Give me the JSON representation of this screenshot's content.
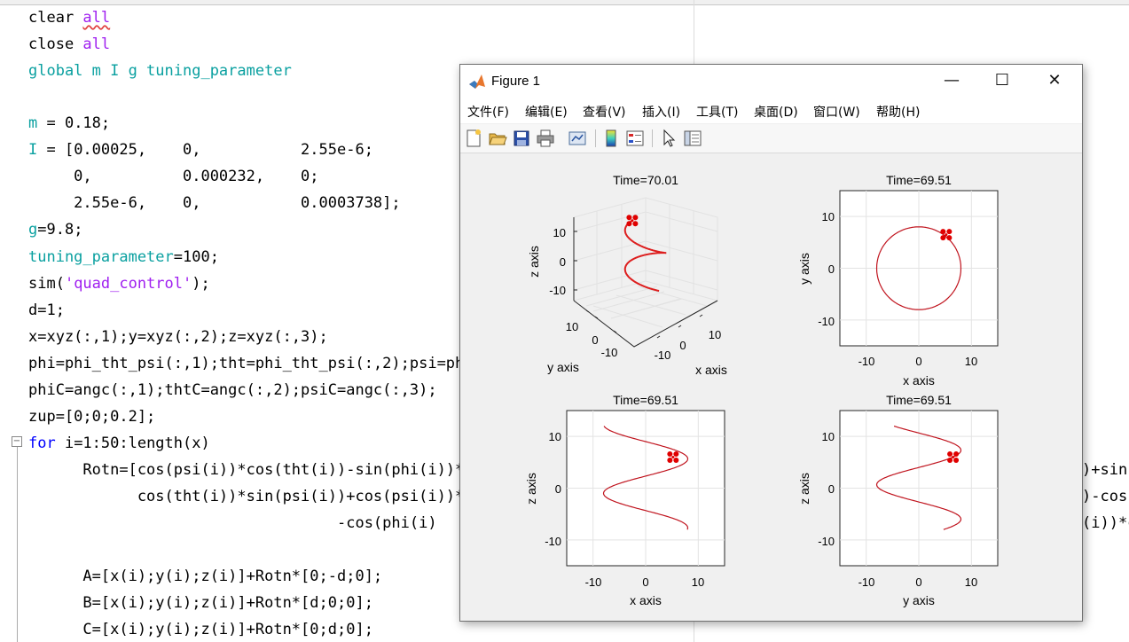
{
  "editor": {
    "l1": {
      "a": "clear ",
      "b": "all"
    },
    "l2": {
      "a": "close ",
      "b": "all"
    },
    "l3": "global m I g tuning_parameter",
    "l5": {
      "a": "m",
      "b": " = 0.18;"
    },
    "l6": {
      "a": "I",
      "b": " = [0.00025,    0,           2.55e-6;"
    },
    "l7": "     0,          0.000232,    0;",
    "l8": "     2.55e-6,    0,           0.0003738];",
    "l9": {
      "a": "g",
      "b": "=9.8;"
    },
    "l10": {
      "a": "tuning_parameter",
      "b": "=100;"
    },
    "l11": {
      "a": "sim(",
      "b": "'quad_control'",
      "c": ");"
    },
    "l12": "d=1;",
    "l13": "x=xyz(:,1);y=xyz(:,2);z=xyz(:,3);",
    "l14": "phi=phi_tht_psi(:,1);tht=phi_tht_psi(:,2);psi=phi",
    "l15": "phiC=angc(:,1);thtC=angc(:,2);psiC=angc(:,3);",
    "l16": "zup=[0;0;0.2];",
    "l17": {
      "a": "for",
      "b": " i=1:50:length(x)"
    },
    "l18": "      Rotn=[cos(psi(i))*cos(tht(i))-sin(phi(i))*s",
    "l18r": ")+sin",
    "l19": "            cos(tht(i))*sin(psi(i))+cos(psi(i))*s",
    "l19r": ")-cos",
    "l20": "                                  -cos(phi(i)",
    "l20r": "(i))*c",
    "l22": "      A=[x(i);y(i);z(i)]+Rotn*[0;-d;0];",
    "l23": "      B=[x(i);y(i);z(i)]+Rotn*[d;0;0];",
    "l24": "      C=[x(i);y(i);z(i)]+Rotn*[0;d;0];",
    "fold": "−"
  },
  "figure": {
    "title": "Figure 1",
    "window_controls": {
      "minimize": "—",
      "maximize": "☐",
      "close": "✕"
    },
    "menus": [
      "文件(F)",
      "编辑(E)",
      "查看(V)",
      "插入(I)",
      "工具(T)",
      "桌面(D)",
      "窗口(W)",
      "帮助(H)"
    ],
    "dock_glyph": "↘",
    "toolbar_icons": [
      "new-figure-icon",
      "open-file-icon",
      "save-icon",
      "print-icon",
      "link-plot-icon",
      "insert-colorbar-icon",
      "insert-legend-icon",
      "edit-plot-arrow-icon",
      "property-inspector-icon"
    ]
  },
  "chart_data": [
    {
      "type": "line",
      "view": "3d",
      "title": "Time=70.01",
      "xlabel": "x axis",
      "ylabel": "y axis",
      "zlabel": "z axis",
      "xticks": [
        "-10",
        "0",
        "10"
      ],
      "yticks": [
        "10",
        "0",
        "-10"
      ],
      "zticks": [
        "10",
        "0",
        "-10"
      ],
      "series_color": "#dd1e1e",
      "marker_color": "#e00000",
      "description_values": {
        "radius": 8,
        "z_range": [
          -8,
          12
        ]
      }
    },
    {
      "type": "line",
      "title": "Time=69.51",
      "xlabel": "x axis",
      "ylabel": "y axis",
      "xlim": [
        -15,
        15
      ],
      "ylim": [
        -15,
        15
      ],
      "xticks": [
        -10,
        0,
        10
      ],
      "yticks": [
        10,
        0,
        -10
      ],
      "grid": true,
      "series_color": "#c0141e",
      "shape": "circle",
      "radius": 8,
      "quad_position": [
        5.2,
        6.5
      ]
    },
    {
      "type": "line",
      "title": "Time=69.51",
      "xlabel": "x axis",
      "ylabel": "z axis",
      "xlim": [
        -15,
        15
      ],
      "ylim": [
        -15,
        15
      ],
      "xticks": [
        -10,
        0,
        10
      ],
      "yticks": [
        10,
        0,
        -10
      ],
      "grid": true,
      "series_color": "#c0141e",
      "shape": "sinusoid",
      "amplitude": 8,
      "z_range": [
        -8,
        12
      ],
      "quad_position": [
        5.2,
        6.0
      ]
    },
    {
      "type": "line",
      "title": "Time=69.51",
      "xlabel": "y axis",
      "ylabel": "z axis",
      "xlim": [
        -15,
        15
      ],
      "ylim": [
        -15,
        15
      ],
      "xticks": [
        -10,
        0,
        10
      ],
      "yticks": [
        10,
        0,
        -10
      ],
      "grid": true,
      "series_color": "#c0141e",
      "shape": "sinusoid",
      "amplitude": 8,
      "z_range": [
        -8,
        12
      ],
      "quad_position": [
        6.5,
        6.0
      ]
    }
  ]
}
